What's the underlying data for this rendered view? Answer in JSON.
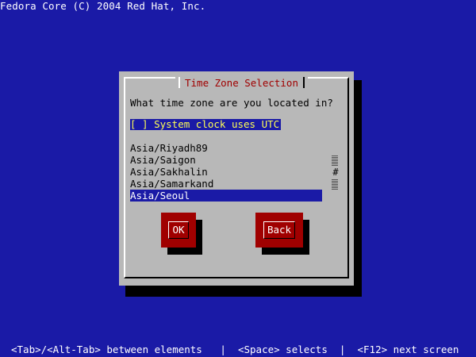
{
  "banner": {
    "text": "Fedora Core (C) 2004 Red Hat, Inc."
  },
  "dialog": {
    "title": "Time Zone Selection",
    "question": "What time zone are you located in?",
    "utc_checkbox": {
      "box": "[ ]",
      "label": "System clock uses UTC"
    },
    "timezones": [
      "Asia/Riyadh89",
      "Asia/Saigon",
      "Asia/Sakhalin",
      "Asia/Samarkand",
      "Asia/Seoul"
    ],
    "selected_timezone": "Asia/Seoul",
    "scrollbar_thumb": "#",
    "buttons": {
      "ok": "OK",
      "back": "Back"
    }
  },
  "status_bar": {
    "text": "<Tab>/<Alt-Tab> between elements   |  <Space> selects  |  <F12> next screen"
  },
  "colors": {
    "background": "#1a1aa6",
    "dialog": "#b8b8b8",
    "accent_red": "#a00000",
    "highlight_yellow": "#ffff55"
  }
}
